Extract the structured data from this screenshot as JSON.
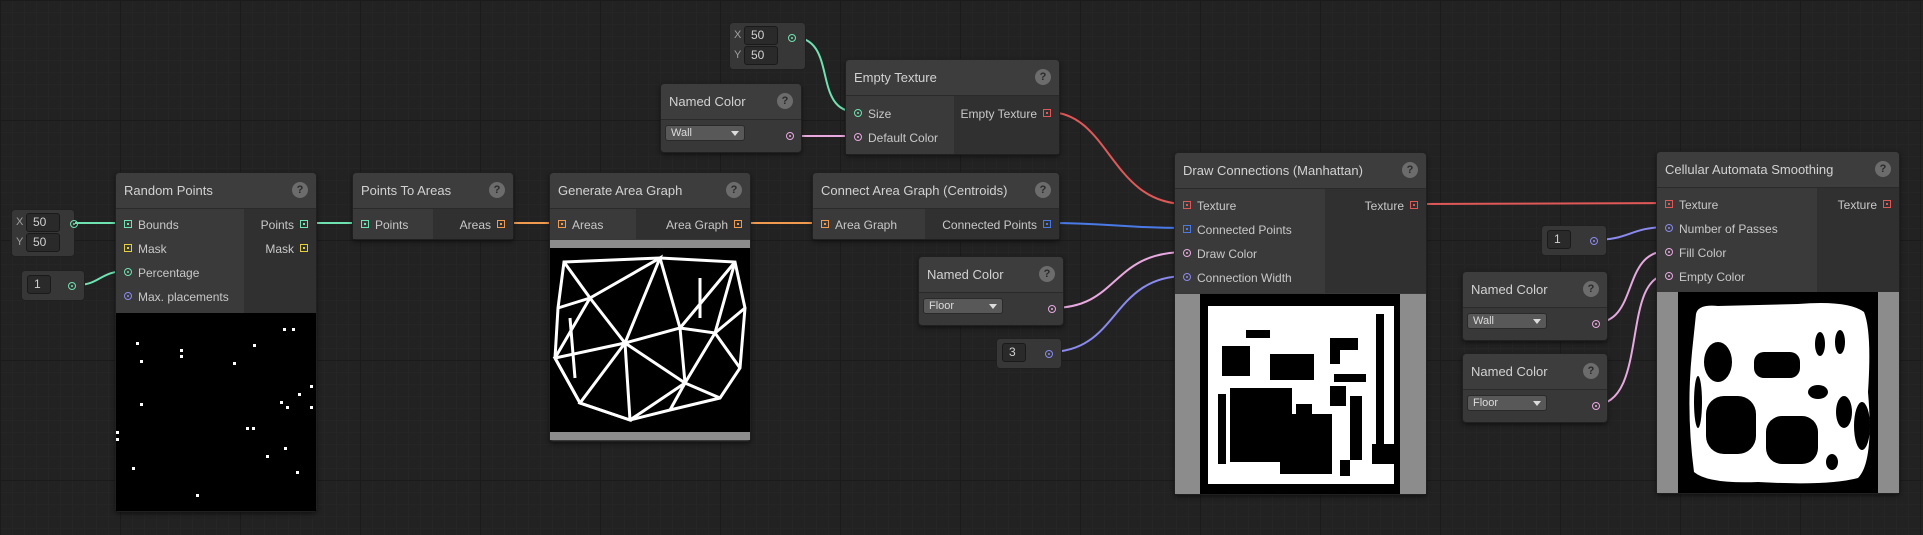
{
  "nodes": {
    "random_points": {
      "title": "Random Points",
      "inputs": [
        "Bounds",
        "Mask",
        "Percentage",
        "Max. placements"
      ],
      "outputs": [
        "Points",
        "Mask"
      ]
    },
    "points_to_areas": {
      "title": "Points To Areas",
      "inputs": [
        "Points"
      ],
      "outputs": [
        "Areas"
      ]
    },
    "generate_area_graph": {
      "title": "Generate Area Graph",
      "inputs": [
        "Areas"
      ],
      "outputs": [
        "Area Graph"
      ]
    },
    "connect_area_graph": {
      "title": "Connect Area Graph (Centroids)",
      "inputs": [
        "Area Graph"
      ],
      "outputs": [
        "Connected Points"
      ]
    },
    "empty_texture": {
      "title": "Empty Texture",
      "inputs": [
        "Size",
        "Default Color"
      ],
      "outputs": [
        "Empty Texture"
      ]
    },
    "named_color_wall_top": {
      "title": "Named Color",
      "value": "Wall"
    },
    "named_color_floor_mid": {
      "title": "Named Color",
      "value": "Floor"
    },
    "draw_connections": {
      "title": "Draw Connections (Manhattan)",
      "inputs": [
        "Texture",
        "Connected Points",
        "Draw Color",
        "Connection Width"
      ],
      "outputs": [
        "Texture"
      ]
    },
    "named_color_wall_right": {
      "title": "Named Color",
      "value": "Wall"
    },
    "named_color_floor_right": {
      "title": "Named Color",
      "value": "Floor"
    },
    "cellular_automata": {
      "title": "Cellular Automata Smoothing",
      "inputs": [
        "Texture",
        "Number of Passes",
        "Fill Color",
        "Empty Color"
      ],
      "outputs": [
        "Texture"
      ]
    }
  },
  "values": {
    "bounds_x_label": "X",
    "bounds_x": "50",
    "bounds_y_label": "Y",
    "bounds_y": "50",
    "percentage": "1",
    "size_x_label": "X",
    "size_x": "50",
    "size_y_label": "Y",
    "size_y": "50",
    "connection_width": "3",
    "number_of_passes": "1"
  },
  "help_label": "?",
  "icons": [
    "help-icon",
    "dropdown-arrow-icon",
    "port-pin-icon"
  ],
  "colors": {
    "background": "#222222",
    "node": "#383838",
    "wire_green": "#6ee2b0",
    "wire_pink": "#e8a8e0",
    "wire_orange": "#f09a50",
    "wire_red": "#e05858",
    "wire_blue": "#4a7ae8",
    "wire_lavender": "#8a8af0"
  }
}
